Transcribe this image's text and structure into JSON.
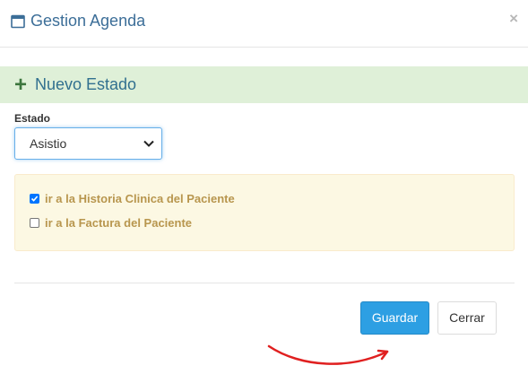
{
  "modal": {
    "title": "Gestion Agenda",
    "close_label": "×"
  },
  "banner": {
    "title": "Nuevo Estado",
    "icon": "plus-icon"
  },
  "form": {
    "estado_label": "Estado",
    "estado_value": "Asistio"
  },
  "options": [
    {
      "label": "ir a la Historia Clinica del Paciente",
      "checked": true
    },
    {
      "label": "ir a la Factura del Paciente",
      "checked": false
    }
  ],
  "buttons": {
    "save_label": "Guardar",
    "close_label": "Cerrar"
  },
  "colors": {
    "primary": "#2d9fe3",
    "banner_bg": "#dff0d8",
    "panel_bg": "#fcf8e3",
    "annotation_arrow": "#e02020"
  }
}
